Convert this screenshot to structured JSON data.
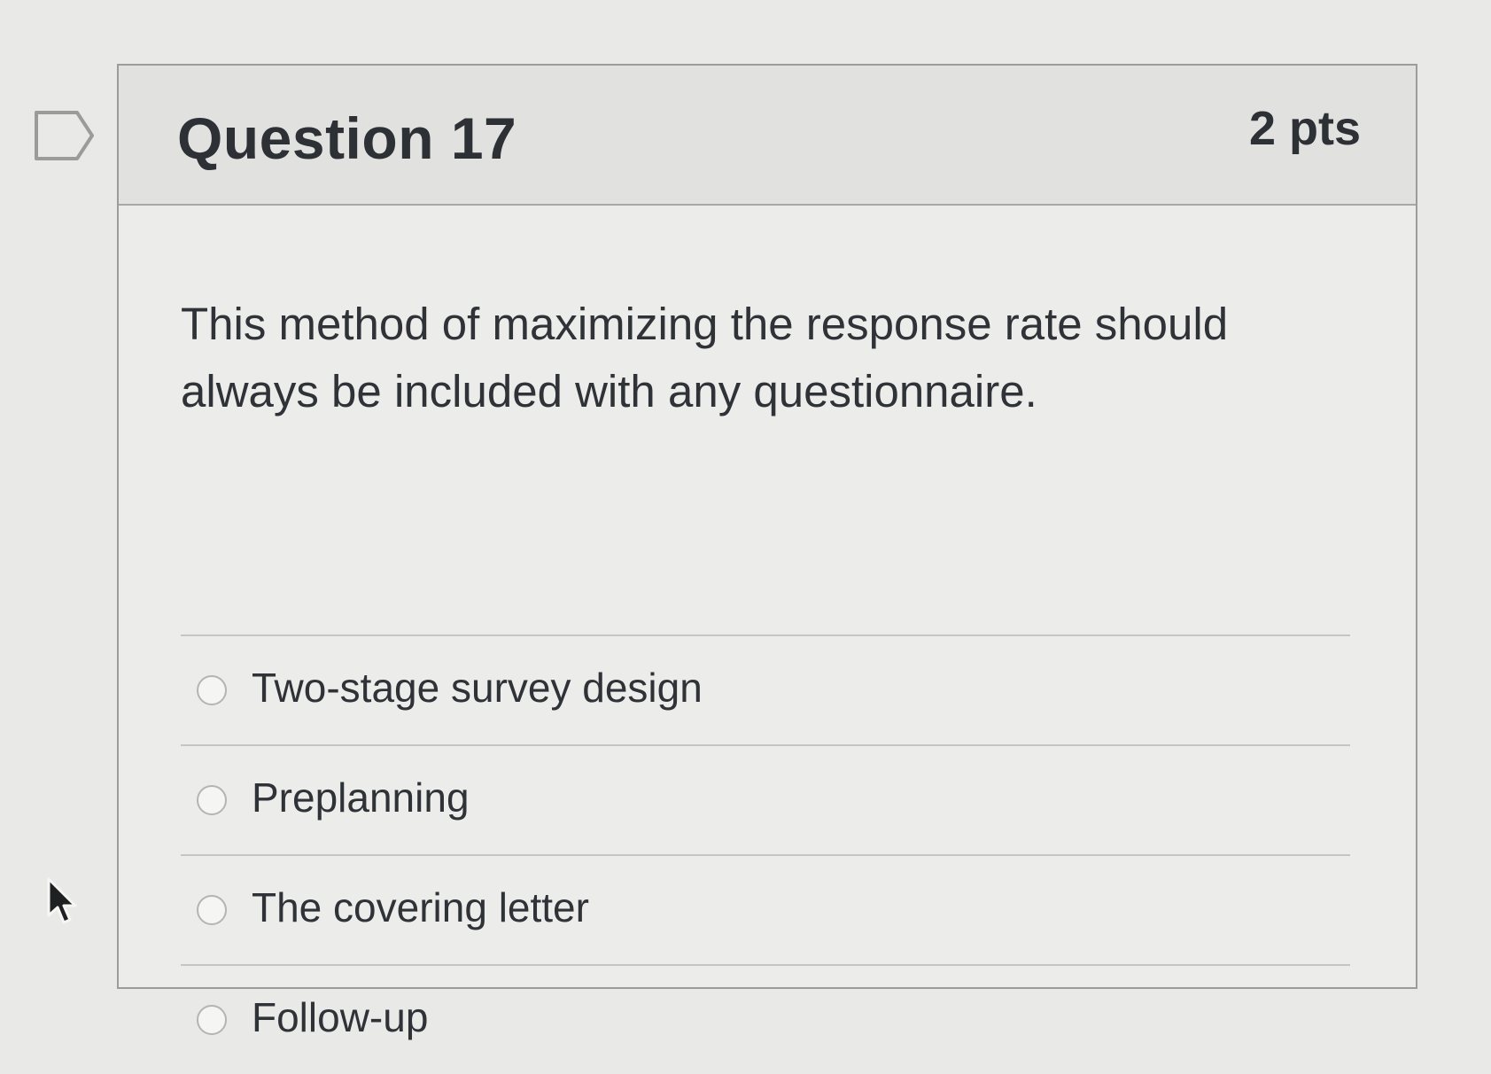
{
  "question": {
    "title": "Question 17",
    "points": "2 pts",
    "text": "This method of maximizing the response rate should always be included with any questionnaire.",
    "answers": [
      {
        "label": "Two-stage survey design",
        "selected": false
      },
      {
        "label": "Preplanning",
        "selected": false
      },
      {
        "label": "The covering letter",
        "selected": false
      },
      {
        "label": "Follow-up",
        "selected": false
      }
    ]
  },
  "icons": {
    "flag": "flag-icon",
    "cursor": "mouse-cursor-icon"
  },
  "colors": {
    "background": "#e9e9e7",
    "header": "#e1e1df",
    "text": "#2f3237",
    "border": "#9c9c9a"
  }
}
